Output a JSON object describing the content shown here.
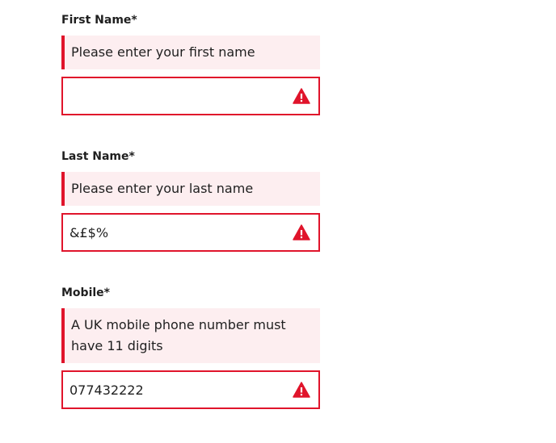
{
  "form": {
    "fields": [
      {
        "label": "First Name*",
        "error": "Please enter your first name",
        "value": "",
        "icon": "warning-icon"
      },
      {
        "label": "Last Name*",
        "error": "Please enter your last name",
        "value": "&£$%",
        "icon": "warning-icon"
      },
      {
        "label": "Mobile*",
        "error": "A UK mobile phone number must have 11 digits",
        "value": "077432222",
        "icon": "warning-icon"
      }
    ]
  },
  "colors": {
    "error_accent": "#e0142b",
    "error_background": "#fdeef0",
    "text": "#1f1f1f"
  }
}
